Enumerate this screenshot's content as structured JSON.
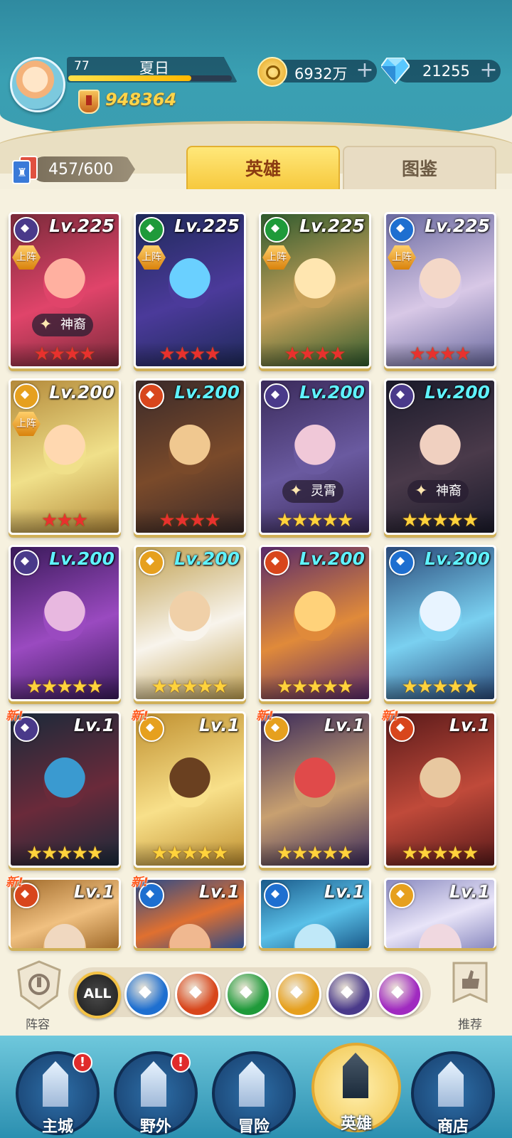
{
  "player": {
    "level": "77",
    "name": "夏日",
    "exp_fraction": 0.75,
    "power": "948364"
  },
  "resources": {
    "gold": "6932万",
    "gems": "21255",
    "add_symbol": "+"
  },
  "roster": {
    "count": "457/600"
  },
  "tabs": [
    {
      "label": "英雄",
      "active": true
    },
    {
      "label": "图鉴",
      "active": false
    }
  ],
  "heroes": [
    {
      "level": "Lv.225",
      "faction": "dark",
      "deployed": "上阵",
      "tag": "神裔",
      "stars": 4,
      "star_color": "red",
      "new": "",
      "art": [
        "#7a2a3a",
        "#e0446a",
        "#ffb0a0"
      ]
    },
    {
      "level": "Lv.225",
      "faction": "green",
      "deployed": "上阵",
      "tag": "",
      "stars": 4,
      "star_color": "red",
      "new": "",
      "art": [
        "#1f2a5a",
        "#4b3a9a",
        "#6ad0ff"
      ]
    },
    {
      "level": "Lv.225",
      "faction": "green",
      "deployed": "上阵",
      "tag": "",
      "stars": 4,
      "star_color": "red",
      "new": "",
      "art": [
        "#2e5a2e",
        "#c9a25a",
        "#ffe6b0"
      ]
    },
    {
      "level": "Lv.225",
      "faction": "blue",
      "deployed": "上阵",
      "tag": "",
      "stars": 4,
      "star_color": "red",
      "new": "",
      "art": [
        "#6a6aa0",
        "#d8c8e6",
        "#f4d8c8"
      ]
    },
    {
      "level": "Lv.200",
      "faction": "light",
      "deployed": "上阵",
      "tag": "",
      "stars": 3,
      "star_color": "red",
      "new": "",
      "art": [
        "#b48a3a",
        "#f0e08a",
        "#ffd8b0"
      ]
    },
    {
      "level": "Lv.200",
      "faction": "fire",
      "deployed": "",
      "tag": "",
      "stars": 4,
      "star_color": "red",
      "new": "",
      "art": [
        "#3a2a2a",
        "#7a4a2a",
        "#f0c890"
      ],
      "cyan": true
    },
    {
      "level": "Lv.200",
      "faction": "dark",
      "deployed": "",
      "tag": "灵霄",
      "stars": 5,
      "star_color": "gold",
      "new": "",
      "art": [
        "#3a2a5a",
        "#6a5aa0",
        "#f0c8d8"
      ],
      "cyan": true
    },
    {
      "level": "Lv.200",
      "faction": "dark",
      "deployed": "",
      "tag": "神裔",
      "stars": 5,
      "star_color": "gold",
      "new": "",
      "art": [
        "#1a1a2a",
        "#4a3a4a",
        "#f0d0c0"
      ],
      "cyan": true
    },
    {
      "level": "Lv.200",
      "faction": "dark",
      "deployed": "",
      "tag": "",
      "stars": 5,
      "star_color": "gold",
      "new": "",
      "art": [
        "#3a1a5a",
        "#9a4ac0",
        "#e8b8e0"
      ],
      "cyan": true
    },
    {
      "level": "Lv.200",
      "faction": "light",
      "deployed": "",
      "tag": "",
      "stars": 5,
      "star_color": "gold",
      "new": "",
      "art": [
        "#c0a050",
        "#f8f4ec",
        "#f0d0a8"
      ],
      "cyan": true
    },
    {
      "level": "Lv.200",
      "faction": "fire",
      "deployed": "",
      "tag": "",
      "stars": 5,
      "star_color": "gold",
      "new": "",
      "art": [
        "#5a2a6a",
        "#e08a3a",
        "#ffd27a"
      ],
      "cyan": true
    },
    {
      "level": "Lv.200",
      "faction": "blue",
      "deployed": "",
      "tag": "",
      "stars": 5,
      "star_color": "gold",
      "new": "",
      "art": [
        "#2a4a7a",
        "#7ad0f0",
        "#e8f4ff"
      ],
      "cyan": true
    },
    {
      "level": "Lv.1",
      "faction": "dark",
      "deployed": "",
      "tag": "",
      "stars": 5,
      "star_color": "gold",
      "new": "新!",
      "art": [
        "#1a2a3a",
        "#6a2a3a",
        "#3a9ad0"
      ]
    },
    {
      "level": "Lv.1",
      "faction": "light",
      "deployed": "",
      "tag": "",
      "stars": 5,
      "star_color": "gold",
      "new": "新!",
      "art": [
        "#c09030",
        "#f8e08a",
        "#6a4020"
      ]
    },
    {
      "level": "Lv.1",
      "faction": "light",
      "deployed": "",
      "tag": "",
      "stars": 5,
      "star_color": "gold",
      "new": "新!",
      "art": [
        "#3a2a5a",
        "#c8a070",
        "#e04a4a"
      ]
    },
    {
      "level": "Lv.1",
      "faction": "fire",
      "deployed": "",
      "tag": "",
      "stars": 5,
      "star_color": "gold",
      "new": "新!",
      "art": [
        "#5a1a1a",
        "#c04a3a",
        "#e8c8a0"
      ]
    },
    {
      "level": "Lv.1",
      "faction": "fire",
      "deployed": "",
      "tag": "",
      "stars": 0,
      "star_color": "gold",
      "new": "新!",
      "art": [
        "#a06a2a",
        "#f0c080",
        "#f0d8c0"
      ]
    },
    {
      "level": "Lv.1",
      "faction": "blue",
      "deployed": "",
      "tag": "",
      "stars": 0,
      "star_color": "gold",
      "new": "新!",
      "art": [
        "#2a4a8a",
        "#e07030",
        "#f0b890"
      ]
    },
    {
      "level": "Lv.1",
      "faction": "blue",
      "deployed": "",
      "tag": "",
      "stars": 0,
      "star_color": "gold",
      "new": "",
      "art": [
        "#1a5a8a",
        "#5ac0e8",
        "#c0e8f8"
      ]
    },
    {
      "level": "Lv.1",
      "faction": "light",
      "deployed": "",
      "tag": "",
      "stars": 0,
      "star_color": "gold",
      "new": "",
      "art": [
        "#8a8ac0",
        "#e8e4f8",
        "#f0d8e0"
      ]
    }
  ],
  "faction_filters": [
    {
      "name": "all",
      "label": "ALL",
      "color": "#2a2a2a"
    },
    {
      "name": "water",
      "label": "",
      "color": "#1e6fd0"
    },
    {
      "name": "fire",
      "label": "",
      "color": "#d8461c"
    },
    {
      "name": "wind",
      "label": "",
      "color": "#1f9a3a"
    },
    {
      "name": "light",
      "label": "",
      "color": "#e6a01e"
    },
    {
      "name": "dark",
      "label": "",
      "color": "#4a3a8a"
    },
    {
      "name": "arcane",
      "label": "",
      "color": "#a02ac0"
    }
  ],
  "side_buttons": {
    "left_label": "阵容",
    "right_label": "推荐"
  },
  "nav": [
    {
      "label": "主城",
      "alert": "!"
    },
    {
      "label": "野外",
      "alert": "!"
    },
    {
      "label": "冒险",
      "alert": ""
    },
    {
      "label": "英雄",
      "alert": "",
      "active": true
    },
    {
      "label": "商店",
      "alert": ""
    }
  ],
  "colors": {
    "faction_dark": "#4a3a8a",
    "faction_green": "#1f9a3a",
    "faction_blue": "#1e6fd0",
    "faction_light": "#e6a01e",
    "faction_fire": "#d8461c"
  }
}
